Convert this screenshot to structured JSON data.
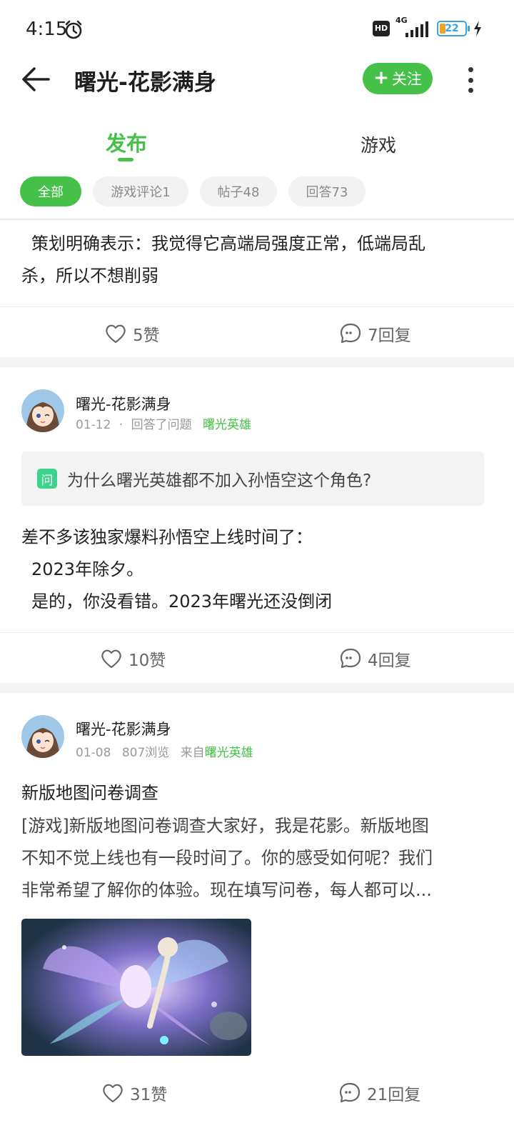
{
  "status_bar": {
    "time": "4:15",
    "hd": "HD",
    "network": "4G",
    "battery": "22"
  },
  "header": {
    "title": "曙光-花影满身",
    "follow_label": "关注"
  },
  "tabs": [
    {
      "label": "发布",
      "active": true
    },
    {
      "label": "游戏",
      "active": false
    }
  ],
  "filters": [
    {
      "label": "全部",
      "active": true
    },
    {
      "label": "游戏评论1",
      "active": false
    },
    {
      "label": "帖子48",
      "active": false
    },
    {
      "label": "回答73",
      "active": false
    }
  ],
  "posts": [
    {
      "lines": [
        "策划明确表示：我觉得它高端局强度正常，低端局乱",
        "杀，所以不想削弱"
      ],
      "likes": "5赞",
      "replies": "7回复"
    },
    {
      "author": "曙光-花影满身",
      "date": "01-12",
      "separator": "·",
      "activity": "回答了问题",
      "tag": "曙光英雄",
      "question_badge": "问",
      "question": "为什么曙光英雄都不加入孙悟空这个角色?",
      "lines": [
        "差不多该独家爆料孙悟空上线时间了：",
        "2023年除夕。",
        "是的，你没看错。2023年曙光还没倒闭"
      ],
      "likes": "10赞",
      "replies": "4回复"
    },
    {
      "author": "曙光-花影满身",
      "date": "01-08",
      "views": "807浏览",
      "source_prefix": "来自",
      "source": "曙光英雄",
      "title": "新版地图问卷调查",
      "lines": [
        "[游戏]新版地图问卷调查大家好，我是花影。新版地图",
        "不知不觉上线也有一段时间了。你的感受如何呢？我们",
        "非常希望了解你的体验。现在填写问卷，每人都可以..."
      ],
      "likes": "31赞",
      "replies": "21回复"
    }
  ],
  "colors": {
    "accent": "#45c149",
    "text": "#222222",
    "muted": "#999999"
  }
}
